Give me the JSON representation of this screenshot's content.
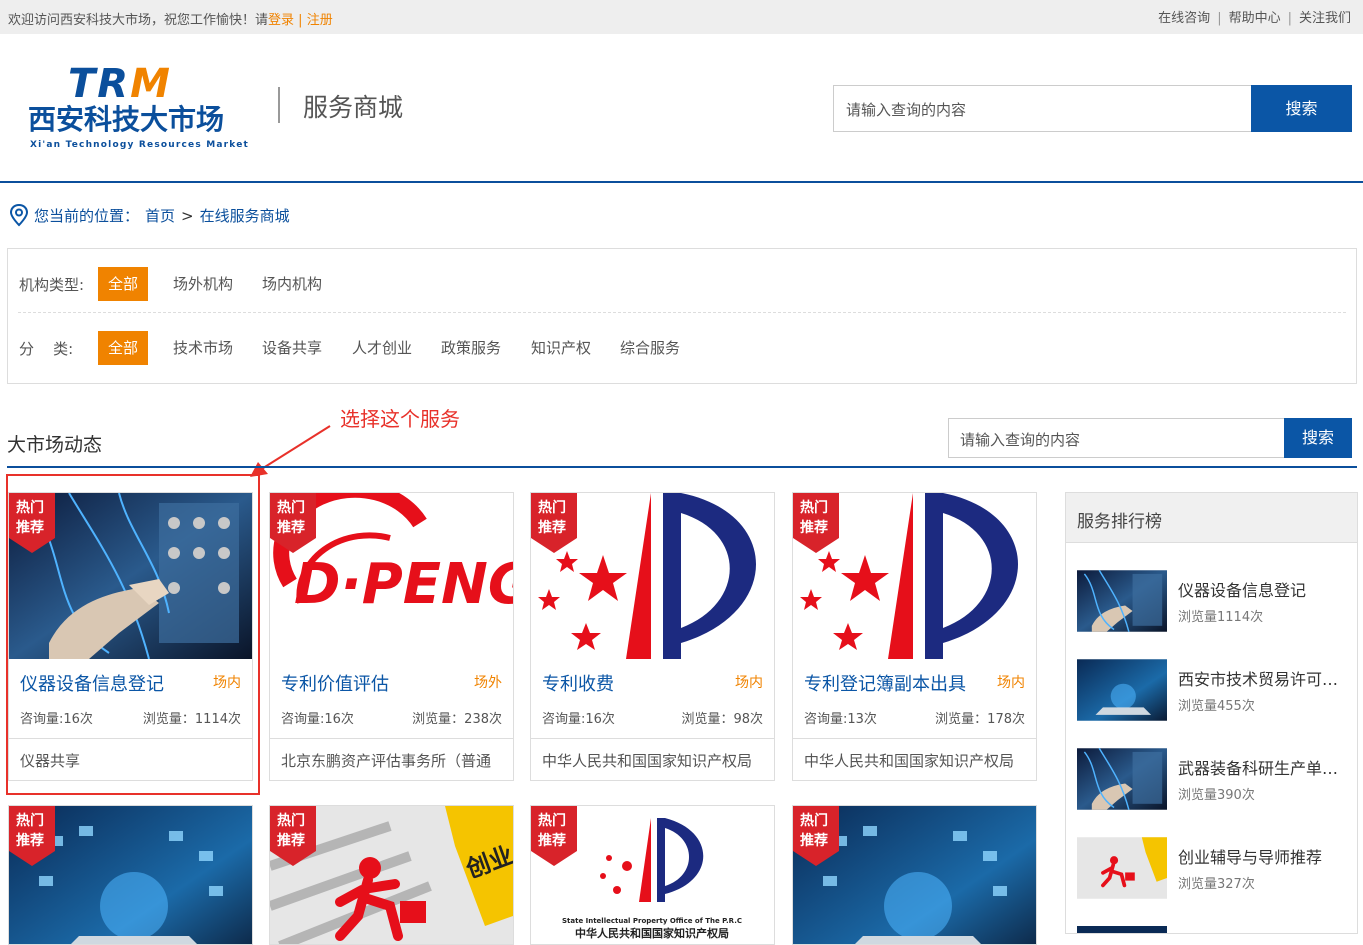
{
  "topbar": {
    "welcome": "欢迎访问西安科技大市场，祝您工作愉快！请",
    "login": "登录",
    "sep": " | ",
    "register": "注册",
    "links": [
      "在线咨询",
      "帮助中心",
      "关注我们"
    ],
    "link_sep": "|"
  },
  "logo": {
    "abbr_main": "TR",
    "abbr_accent": "M",
    "cn": "西安科技大市场",
    "en": "Xi'an Technology Resources Market"
  },
  "header": {
    "title": "服务商城",
    "search_placeholder": "请输入查询的内容",
    "search_button": "搜索"
  },
  "breadcrumb": {
    "label": "您当前的位置：",
    "items": [
      "首页",
      "在线服务商城"
    ],
    "separator": ">"
  },
  "filters": {
    "org_type": {
      "label": "机构类型:",
      "options": [
        "全部",
        "场外机构",
        "场内机构"
      ],
      "selected": "全部"
    },
    "category": {
      "label": "分    类:",
      "options": [
        "全部",
        "技术市场",
        "设备共享",
        "人才创业",
        "政策服务",
        "知识产权",
        "综合服务"
      ],
      "selected": "全部"
    }
  },
  "section": {
    "title": "大市场动态",
    "annotation": "选择这个服务",
    "search_placeholder": "请输入查询的内容",
    "search_button": "搜索"
  },
  "badge": {
    "line1": "热门",
    "line2": "推荐"
  },
  "cards": [
    {
      "name": "仪器设备信息登记",
      "kind": "场内",
      "consult": "咨询量:16次",
      "views": "浏览量：1114次",
      "org": "仪器共享",
      "image": "lab-equipment"
    },
    {
      "name": "专利价值评估",
      "kind": "场外",
      "consult": "咨询量:16次",
      "views": "浏览量：238次",
      "org": "北京东鹏资产评估事务所（普通",
      "image": "dpeng-logo"
    },
    {
      "name": "专利收费",
      "kind": "场内",
      "consult": "咨询量:16次",
      "views": "浏览量：98次",
      "org": "中华人民共和国国家知识产权局",
      "image": "sipo-logo"
    },
    {
      "name": "专利登记簿副本出具",
      "kind": "场内",
      "consult": "咨询量:13次",
      "views": "浏览量：178次",
      "org": "中华人民共和国国家知识产权局",
      "image": "sipo-logo"
    }
  ],
  "cards_row2": [
    {
      "image": "tech-laptop"
    },
    {
      "image": "startup-runner",
      "sign": "创业"
    },
    {
      "image": "sipo-small",
      "caption1": "State Intellectual Property Office of The P.R.C",
      "caption2": "中华人民共和国国家知识产权局"
    },
    {
      "image": "tech-laptop"
    }
  ],
  "dpeng_text": "D·PENG",
  "ranking": {
    "title": "服务排行榜",
    "items": [
      {
        "name": "仪器设备信息登记",
        "views": "浏览量1114次",
        "image": "lab-equipment"
      },
      {
        "name": "西安市技术贸易许可证…",
        "views": "浏览量455次",
        "image": "tech-laptop"
      },
      {
        "name": "武器装备科研生产单位…",
        "views": "浏览量390次",
        "image": "lab-equipment"
      },
      {
        "name": "创业辅导与导师推荐",
        "views": "浏览量327次",
        "image": "startup-runner"
      }
    ]
  },
  "colors": {
    "brand_blue": "#0b4f9c",
    "button_blue": "#0b56a6",
    "accent_orange": "#f08300",
    "annotation_red": "#e8312a"
  }
}
